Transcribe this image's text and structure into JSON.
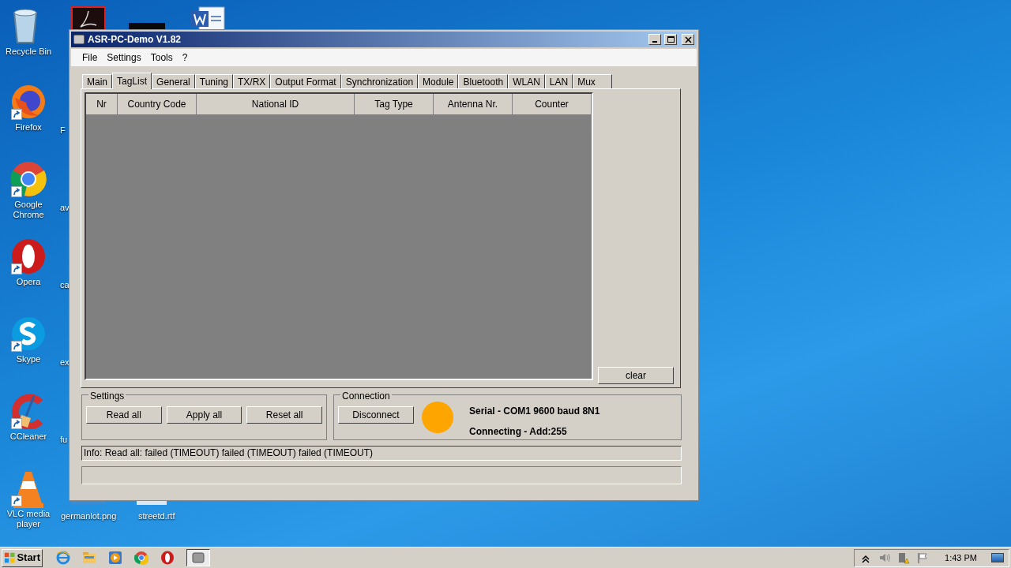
{
  "desktop_icons": [
    {
      "kind": "recycle",
      "label": "Recycle Bin"
    },
    {
      "kind": "firefox",
      "label": "Firefox"
    },
    {
      "kind": "chrome",
      "label": "Google Chrome"
    },
    {
      "kind": "opera",
      "label": "Opera"
    },
    {
      "kind": "skype",
      "label": "Skype"
    },
    {
      "kind": "ccleaner",
      "label": "CCleaner"
    },
    {
      "kind": "vlc",
      "label": "VLC media player"
    },
    {
      "kind": "acrobat"
    },
    {
      "kind": "dark"
    },
    {
      "kind": "word"
    }
  ],
  "partial_labels": [
    "F",
    "av",
    "ca",
    "ex",
    "fu"
  ],
  "file_labels": [
    "germanlot.png",
    "streetd.rtf"
  ],
  "window": {
    "title": "ASR-PC-Demo V1.82",
    "menu": [
      "File",
      "Settings",
      "Tools",
      "?"
    ],
    "tabs": [
      {
        "label": "Main",
        "selected": false
      },
      {
        "label": "TagList",
        "selected": true
      },
      {
        "label": "General",
        "selected": false
      },
      {
        "label": "Tuning",
        "selected": false
      },
      {
        "label": "TX/RX",
        "selected": false
      },
      {
        "label": "Output Format",
        "selected": false
      },
      {
        "label": "Synchronization",
        "selected": false
      },
      {
        "label": "Module",
        "selected": false
      },
      {
        "label": "Bluetooth",
        "selected": false
      },
      {
        "label": "WLAN",
        "selected": false
      },
      {
        "label": "LAN",
        "selected": false
      },
      {
        "label": "Mux",
        "selected": false
      }
    ],
    "table": {
      "columns": [
        "Nr",
        "Country Code",
        "National ID",
        "Tag Type",
        "Antenna Nr.",
        "Counter"
      ]
    },
    "clear_button": "clear",
    "settings": {
      "title": "Settings",
      "buttons": [
        "Read all",
        "Apply all",
        "Reset all"
      ]
    },
    "connection": {
      "title": "Connection",
      "button": "Disconnect",
      "indicator": {
        "color": "#ffa500"
      },
      "line_1": "Serial - COM1 9600 baud 8N1",
      "line_2": "Connecting - Add:255"
    },
    "info": "Info: Read all: failed (TIMEOUT) failed (TIMEOUT) failed (TIMEOUT)"
  },
  "taskbar": {
    "start": "Start",
    "clock": "1:43 PM"
  }
}
